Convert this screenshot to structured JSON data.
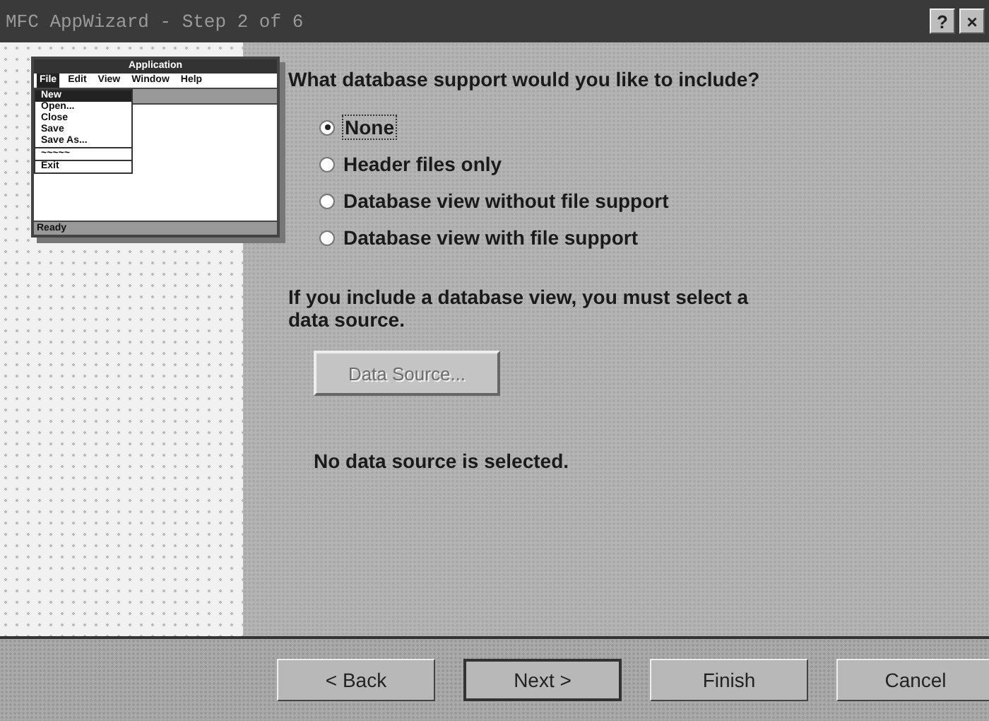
{
  "window": {
    "title": "MFC AppWizard - Step 2 of 6",
    "title_buttons": [
      "?",
      "×"
    ]
  },
  "preview": {
    "title": "Application",
    "menu": [
      {
        "label": "File",
        "selected": true
      },
      {
        "label": "Edit",
        "selected": false
      },
      {
        "label": "View",
        "selected": false
      },
      {
        "label": "Window",
        "selected": false
      },
      {
        "label": "Help",
        "selected": false
      }
    ],
    "menu_items": [
      {
        "label": "New",
        "selected": true,
        "kind": "item"
      },
      {
        "label": "Open...",
        "selected": false,
        "kind": "item"
      },
      {
        "label": "Close",
        "selected": false,
        "kind": "item"
      },
      {
        "label": "Save",
        "selected": false,
        "kind": "item"
      },
      {
        "label": "Save As...",
        "selected": false,
        "kind": "item"
      },
      {
        "label": "~~~~~",
        "selected": false,
        "kind": "separator-item"
      },
      {
        "label": "Exit",
        "selected": false,
        "kind": "separator-item"
      }
    ],
    "status": "Ready"
  },
  "question": "What database support would you like to include?",
  "options": [
    {
      "label": "None",
      "selected": true
    },
    {
      "label": "Header files only",
      "selected": false
    },
    {
      "label": "Database view without file support",
      "selected": false
    },
    {
      "label": "Database view with file support",
      "selected": false
    }
  ],
  "note": "If you include a database view, you must select a data source.",
  "data_source_button": {
    "label": "Data Source...",
    "disabled": true
  },
  "status_text": "No data source is selected.",
  "buttons": [
    {
      "label": "< Back",
      "default": false
    },
    {
      "label": "Next >",
      "default": true
    },
    {
      "label": "Finish",
      "default": false
    },
    {
      "label": "Cancel",
      "default": false
    }
  ]
}
